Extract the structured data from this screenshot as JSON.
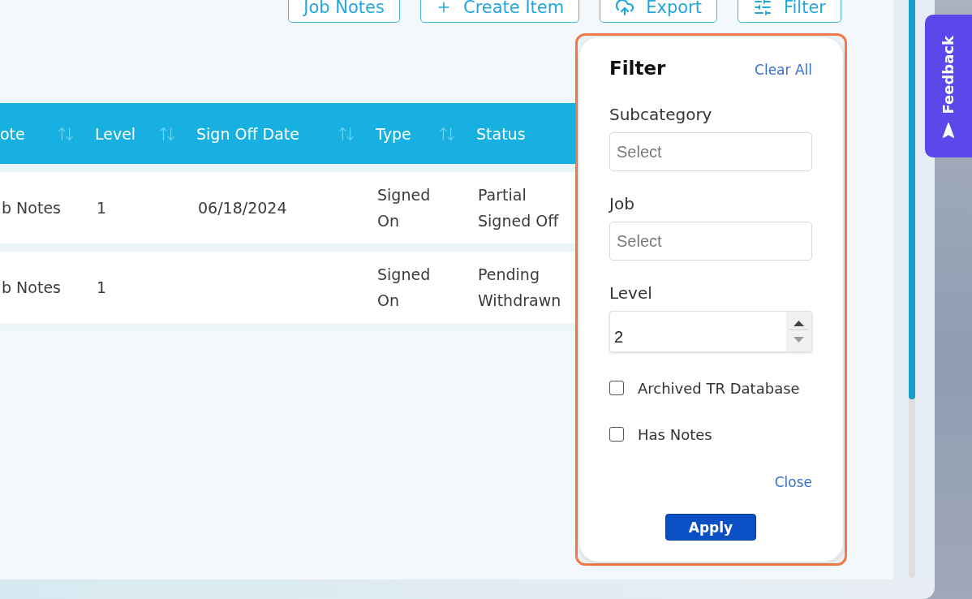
{
  "toolbar": {
    "buttons": [
      {
        "kind": "plain",
        "label": "Job Notes"
      },
      {
        "kind": "create",
        "label": "Create Item"
      },
      {
        "kind": "export",
        "label": "Export"
      },
      {
        "kind": "filter",
        "label": "Filter"
      }
    ]
  },
  "table": {
    "columns": [
      {
        "label": "ote",
        "sortable": true
      },
      {
        "label": "Level",
        "sortable": true
      },
      {
        "label": "Sign Off Date",
        "sortable": true
      },
      {
        "label": "Type",
        "sortable": true
      },
      {
        "label": "Status",
        "sortable": false
      }
    ],
    "rows": [
      {
        "cells": [
          "b Notes",
          "1",
          "06/18/2024",
          "Signed On",
          "Partial Signed Off"
        ]
      },
      {
        "cells": [
          "b Notes",
          "1",
          null,
          "Signed On",
          "Pending Withdrawn"
        ]
      }
    ]
  },
  "filter_panel": {
    "title": "Filter",
    "clear_label": "Clear All",
    "fields": [
      {
        "kind": "select",
        "label": "Subcategory",
        "placeholder": "Select"
      },
      {
        "kind": "select",
        "label": "Job",
        "placeholder": "Select"
      },
      {
        "kind": "listbox",
        "label": "Level",
        "value": "2"
      }
    ],
    "checkboxes": [
      {
        "label": "Archived TR Database",
        "checked": false
      },
      {
        "label": "Has Notes",
        "checked": false
      }
    ],
    "close_label": "Close",
    "apply_label": "Apply"
  },
  "feedback_tab": {
    "label": "Feedback"
  }
}
